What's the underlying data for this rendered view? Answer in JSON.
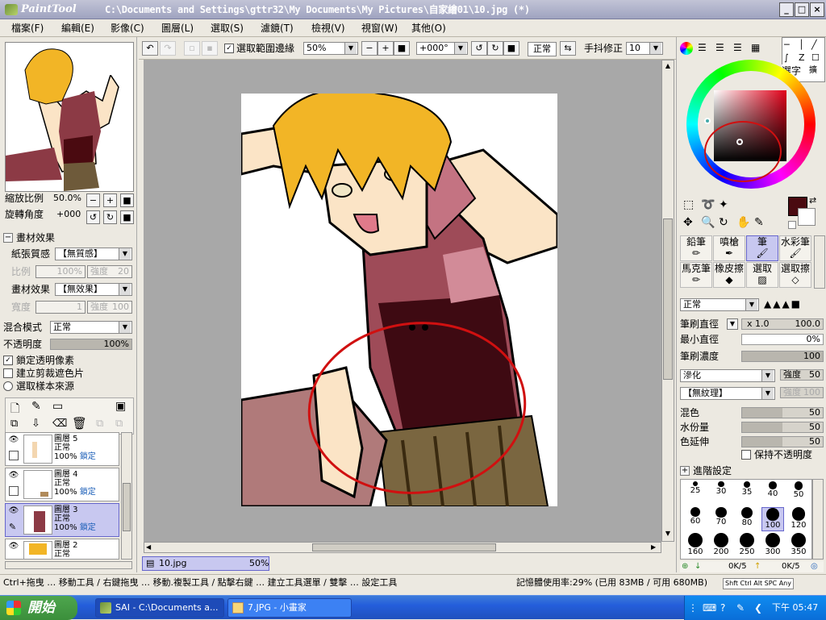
{
  "window": {
    "app_logo_text": "PaintTool SAI",
    "title": "C:\\Documents and Settings\\gttr32\\My Documents\\My Pictures\\自家繪01\\10.jpg (*)"
  },
  "menu": [
    "檔案(F)",
    "編輯(E)",
    "影像(C)",
    "圖層(L)",
    "選取(S)",
    "濾鏡(T)",
    "檢視(V)",
    "視窗(W)",
    "其他(O)"
  ],
  "left": {
    "zoom_label": "縮放比例",
    "zoom_value": "50.0%",
    "rotate_label": "旋轉角度",
    "rotate_value": "+000",
    "brush_effect_header": "畫材效果",
    "paper_texture_label": "紙張質感",
    "paper_texture_value": "【無質感】",
    "scale_label": "比例",
    "scale_value": "100%",
    "strength_label": "強度",
    "strength_value": "20",
    "material_effect_label": "畫材效果",
    "material_effect_value": "【無效果】",
    "width_label": "寬度",
    "width_value": "1",
    "strength2_label": "強度",
    "strength2_value": "100",
    "blend_mode_label": "混合模式",
    "blend_mode_value": "正常",
    "opacity_label": "不透明度",
    "opacity_value": "100%",
    "preserve_opacity_label": "鎖定透明像素",
    "clipping_label": "建立剪裁遮色片",
    "sample_source_label": "選取樣本來源",
    "layers": [
      {
        "name": "圖層 5",
        "mode": "正常",
        "opacity": "100%",
        "lock": "鎖定"
      },
      {
        "name": "圖層 4",
        "mode": "正常",
        "opacity": "100%",
        "lock": "鎖定"
      },
      {
        "name": "圖層 3",
        "mode": "正常",
        "opacity": "100%",
        "lock": "鎖定"
      },
      {
        "name": "圖層 2",
        "mode": "正常",
        "opacity": "",
        "lock": ""
      }
    ]
  },
  "toolbar": {
    "selection_edge_label": "選取範圍邊緣",
    "zoom_value": "50%",
    "rotation_value": "+000°",
    "blend_value": "正常",
    "stabilizer_label": "手抖修正",
    "stabilizer_value": "10"
  },
  "document_tab": {
    "name": "10.jpg",
    "zoom": "50%"
  },
  "right": {
    "color_hex": "#4a0a10",
    "tools": [
      "鉛筆",
      "噴槍",
      "筆",
      "水彩筆",
      "馬克筆",
      "橡皮擦",
      "選取",
      "選取擦"
    ],
    "selected_tool": "筆",
    "brush_mode_value": "正常",
    "brush_size_label": "筆刷直徑",
    "brush_size_mult": "x 1.0",
    "brush_size_value": "100.0",
    "min_size_label": "最小直徑",
    "min_size_value": "0%",
    "density_label": "筆刷濃度",
    "density_value": "100",
    "edge_value": "滲化",
    "edge_strength_label": "強度",
    "edge_strength_value": "50",
    "texture_value": "【無紋理】",
    "texture_strength_label": "強度",
    "texture_strength_value": "100",
    "blending_label": "混色",
    "blending_value": "50",
    "dilution_label": "水份量",
    "dilution_value": "50",
    "persistence_label": "色延伸",
    "persistence_value": "50",
    "keep_opacity_label": "保持不透明度",
    "advanced_label": "進階設定",
    "brush_sizes": [
      "25",
      "30",
      "35",
      "40",
      "50",
      "60",
      "70",
      "80",
      "100",
      "120",
      "160",
      "200",
      "250",
      "300",
      "350"
    ],
    "selected_brush_size": "100",
    "bottom_stat1": "0K/5",
    "bottom_stat2": "0K/5",
    "text_tool_label": "選字",
    "extra_tool_label": "擴"
  },
  "status": {
    "hint": "Ctrl+拖曳 … 移動工具 / 右鍵拖曳 … 移動.複製工具 / 點擊右鍵 … 建立工具選單 / 雙擊 … 設定工具",
    "memory": "記憶體使用率:29% (已用 83MB / 可用 680MB)",
    "keys": "Shft Ctrl Alt SPC Any"
  },
  "taskbar": {
    "start_label": "開始",
    "tasks": [
      "SAI - C:\\Documents a...",
      "7.JPG - 小畫家"
    ],
    "time": "下午 05:47"
  }
}
